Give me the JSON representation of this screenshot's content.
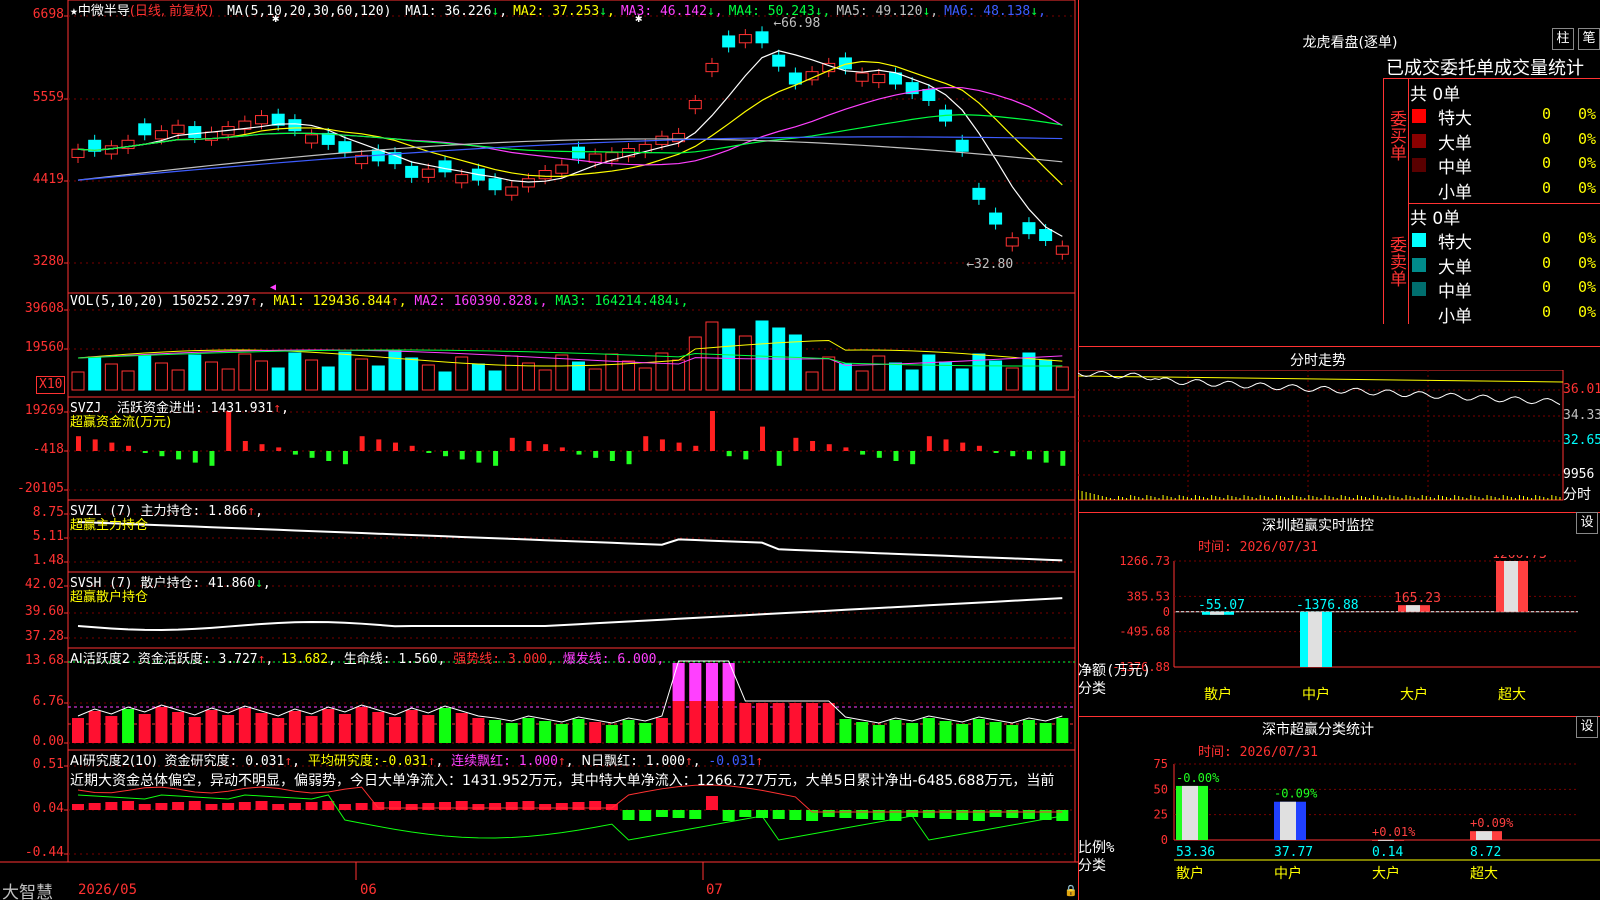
{
  "title": {
    "star": "★",
    "name": "中微半导",
    "mode": "(日线, 前复权)"
  },
  "price_panel": {
    "ticks": [
      "6698",
      "5559",
      "4419",
      "3280"
    ],
    "ma_label": "MA(5,10,20,30,60,120)",
    "ma": [
      {
        "k": "MA1",
        "v": "36.226",
        "a": "↓"
      },
      {
        "k": "MA2",
        "v": "37.253",
        "a": "↓"
      },
      {
        "k": "MA3",
        "v": "46.142",
        "a": "↓"
      },
      {
        "k": "MA4",
        "v": "50.243",
        "a": "↓"
      },
      {
        "k": "MA5",
        "v": "49.120",
        "a": "↓"
      },
      {
        "k": "MA6",
        "v": "48.138",
        "a": "↓"
      }
    ],
    "high_label": "66.98",
    "low_label": "32.80",
    "colors": {
      "MA1": "#ffffff",
      "MA2": "#ffff00",
      "MA3": "#ff40ff",
      "MA4": "#00ff40",
      "MA5": "#c0c0c0",
      "MA6": "#3d5cff"
    }
  },
  "vol_panel": {
    "ticks": [
      "39608",
      "19560"
    ],
    "scale": "X10",
    "label": "VOL(5,10,20)",
    "value": "150252.297",
    "a": "↑",
    "ma": [
      {
        "k": "MA1",
        "v": "129436.844",
        "a": "↑"
      },
      {
        "k": "MA2",
        "v": "160390.828",
        "a": "↓"
      },
      {
        "k": "MA3",
        "v": "164214.484",
        "a": "↓"
      }
    ]
  },
  "svzj": {
    "ticks": [
      "19269",
      "-418",
      "-20105"
    ],
    "name": "SVZJ",
    "desc": "活跃资金进出",
    "value": "1431.931",
    "a": "↑",
    "sub": "超赢资金流(万元)"
  },
  "svzl": {
    "ticks": [
      "8.75",
      "5.11",
      "1.48"
    ],
    "name": "SVZL (7)",
    "desc": "主力持仓",
    "value": "1.866",
    "a": "↑",
    "sub": "超赢主力持仓"
  },
  "svsh": {
    "ticks": [
      "42.02",
      "39.60",
      "37.28"
    ],
    "name": "SVSH (7)",
    "desc": "散户持仓",
    "value": "41.860",
    "a": "↓",
    "sub": "超赢散户持仓"
  },
  "ai_active": {
    "ticks": [
      "13.68",
      "6.76",
      "0.00"
    ],
    "name": "AI活跃度2",
    "items": [
      {
        "k": "资金活跃度",
        "v": "3.727",
        "a": "↑"
      },
      {
        "k": "",
        "v": "13.682",
        "a": ""
      },
      {
        "k": "生命线",
        "v": "1.560",
        "a": ""
      },
      {
        "k": "强势线",
        "v": "3.000",
        "a": ""
      },
      {
        "k": "爆发线",
        "v": "6.000",
        "a": ""
      }
    ]
  },
  "ai_research": {
    "ticks": [
      "0.51",
      "0.04",
      "-0.44"
    ],
    "name": "AI研究度2(10)",
    "items": [
      {
        "k": "资金研究度",
        "v": "0.031",
        "a": "↑"
      },
      {
        "k": "平均研究度",
        "v": "-0.031",
        "a": "↑"
      },
      {
        "k": "连续飘红",
        "v": "1.000",
        "a": "↑"
      },
      {
        "k": "N日飘红",
        "v": "1.000",
        "a": "↑"
      },
      {
        "k": "",
        "v": "-0.031",
        "a": "↑"
      }
    ],
    "comment": "近期大资金总体偏空，异动不明显，偏弱势，今日大单净流入：1431.952万元，其中特大单净流入：1266.727万元，大单5日累计净出-6485.688万元，当前"
  },
  "bottom": {
    "brand": "大智慧",
    "dates": [
      "2026/05",
      "06",
      "07"
    ]
  },
  "lhb": {
    "title": "龙虎看盘(逐单)",
    "btn1": "柱",
    "btn2": "笔",
    "subtitle": "已成交委托单成交量统计",
    "buy": {
      "side": "委买单",
      "total": "共 0单",
      "rows": [
        {
          "name": "特大",
          "n": "0",
          "p": "0%",
          "c": "#ff0000"
        },
        {
          "name": "大单",
          "n": "0",
          "p": "0%",
          "c": "#8b0000"
        },
        {
          "name": "中单",
          "n": "0",
          "p": "0%",
          "c": "#5a0000"
        },
        {
          "name": "小单",
          "n": "0",
          "p": "0%",
          "c": ""
        }
      ]
    },
    "sell": {
      "side": "委卖单",
      "total": "共 0单",
      "rows": [
        {
          "name": "特大",
          "n": "0",
          "p": "0%",
          "c": "#00ffff"
        },
        {
          "name": "大单",
          "n": "0",
          "p": "0%",
          "c": "#008b8b"
        },
        {
          "name": "中单",
          "n": "0",
          "p": "0%",
          "c": "#006e6e"
        },
        {
          "name": "小单",
          "n": "0",
          "p": "0%",
          "c": ""
        }
      ]
    }
  },
  "fenshi": {
    "title": "分时走势",
    "ticks": [
      "36.01",
      "34.33",
      "32.65",
      "9956"
    ],
    "fen": "分时"
  },
  "monitor": {
    "title": "深圳超赢实时监控",
    "btn": "设",
    "time": "时间: 2026/07/31",
    "ylab": "净额(万元)",
    "xlab": "分类"
  },
  "classify": {
    "title": "深市超赢分类统计",
    "btn": "设",
    "time": "时间: 2026/07/31",
    "ylab": "比例%",
    "xlab": "分类"
  },
  "chart_data": [
    {
      "type": "bar",
      "title": "深圳超赢实时监控",
      "categories": [
        "散户",
        "中户",
        "大户",
        "超大"
      ],
      "values": [
        -55.07,
        -1376.88,
        165.23,
        1266.73
      ],
      "ylabel": "净额(万元)",
      "xlabel": "分类",
      "yticks": [
        1266.73,
        385.53,
        0,
        -495.68,
        -1376.88
      ],
      "ylim": [
        -1376.88,
        1266.73
      ]
    },
    {
      "type": "bar",
      "title": "深市超赢分类统计",
      "categories": [
        "散户",
        "中户",
        "大户",
        "超大"
      ],
      "values": [
        53.36,
        37.77,
        0.14,
        8.72
      ],
      "changes": [
        "-0.00%",
        "-0.09%",
        "+0.01%",
        "+0.09%"
      ],
      "ylabel": "比例%",
      "xlabel": "分类",
      "yticks": [
        75,
        50,
        25,
        0
      ],
      "ylim": [
        0,
        75
      ]
    }
  ]
}
